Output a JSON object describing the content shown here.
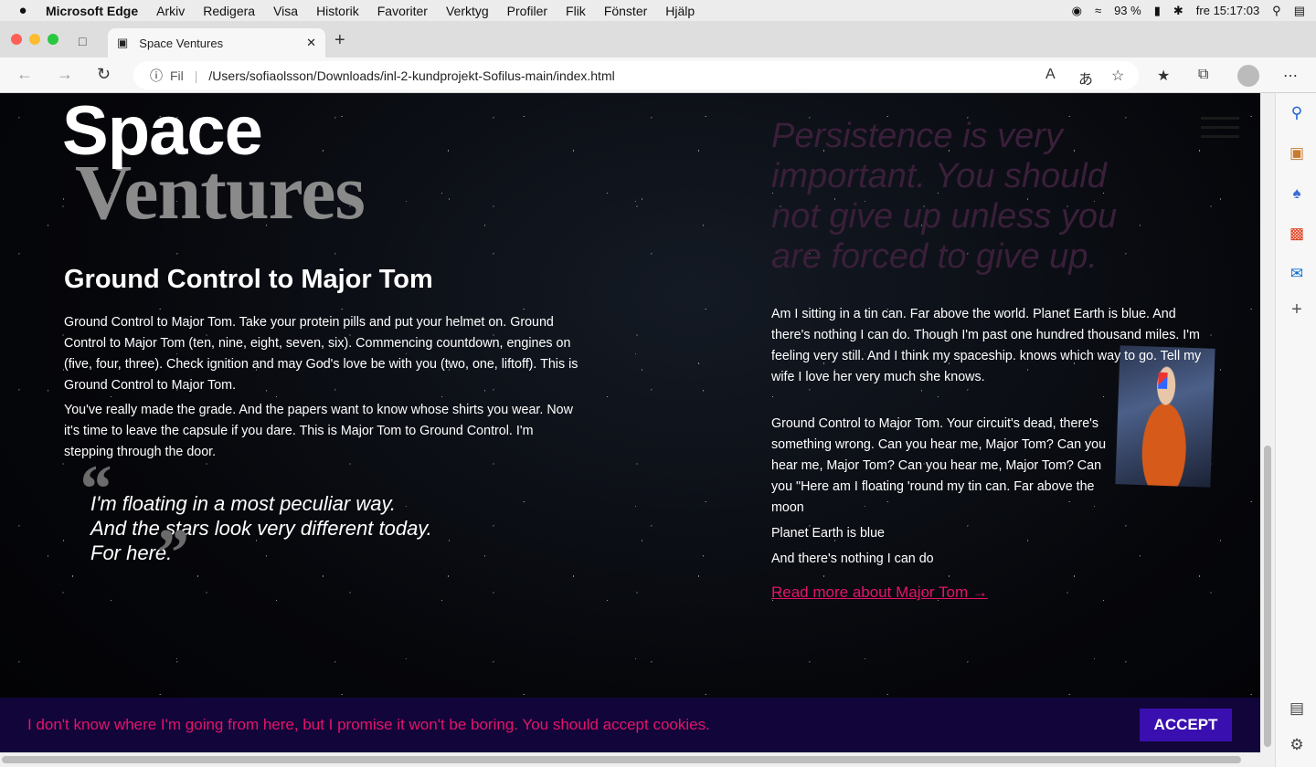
{
  "menubar": {
    "apple": "",
    "app": "Microsoft Edge",
    "items": [
      "Arkiv",
      "Redigera",
      "Visa",
      "Historik",
      "Favoriter",
      "Verktyg",
      "Profiler",
      "Flik",
      "Fönster",
      "Hjälp"
    ],
    "battery": "93 %",
    "clock": "fre 15:17:03"
  },
  "tab": {
    "title": "Space Ventures"
  },
  "address": {
    "fil": "Fil",
    "url": "/Users/sofiaolsson/Downloads/inl-2-kundprojekt-Sofilus-main/index.html"
  },
  "page": {
    "logo_top": "Space",
    "logo_bottom": "Ventures",
    "heading": "Ground Control to Major Tom",
    "left_p1": "Ground Control to Major Tom. Take your protein pills and put your helmet on. Ground Control to Major Tom (ten, nine, eight, seven, six). Commencing countdown, engines on (five, four, three). Check ignition and may God's love be with you (two, one, liftoff). This is Ground Control to Major Tom.",
    "left_p2": "You've really made the grade. And the papers want to know whose shirts you wear. Now it's time to leave the capsule if you dare. This is Major Tom to Ground Control. I'm stepping through the door.",
    "quote_lines": [
      "I'm floating in a most peculiar way.",
      "And the stars look very different today.",
      "For here."
    ],
    "persistence": "Persistence is very important. You should not give up unless you are forced to give up.",
    "right_p1": "Am I sitting in a tin can. Far above the world. Planet Earth is blue. And there's nothing I can do. Though I'm past one hundred thousand miles. I'm feeling very still. And I think my spaceship. knows which way to go. Tell my wife I love her very much she knows.",
    "right_p2": "Ground Control to Major Tom. Your circuit's dead, there's something wrong. Can you hear me, Major Tom? Can you hear me, Major Tom? Can you hear me, Major Tom? Can you \"Here am I floating 'round my tin can. Far above the moon",
    "right_p3": "Planet Earth is blue",
    "right_p4": "And there's nothing I can do",
    "read_more": "Read more about Major Tom"
  },
  "cookie": {
    "text": "I don't know where I'm going from here, but I promise it won't be boring. You should accept cookies.",
    "accept": "ACCEPT"
  },
  "colors": {
    "accent": "#e4136b",
    "cookie_bg": "#12053a",
    "accept_bg": "#3a0fb0"
  }
}
